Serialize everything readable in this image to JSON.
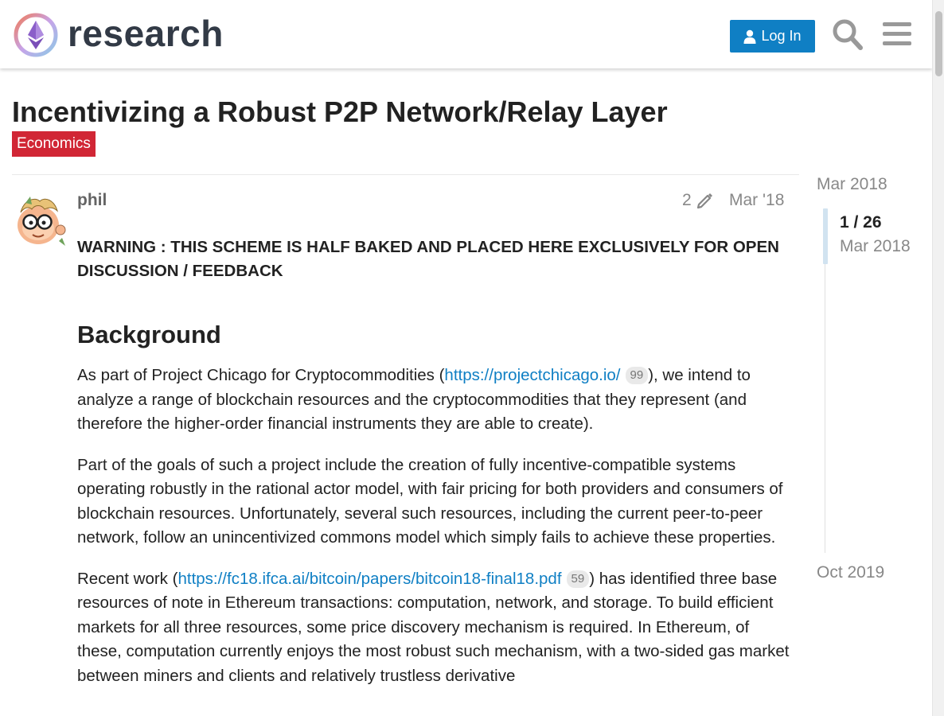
{
  "header": {
    "brand": "research",
    "login_label": "Log In",
    "icons": [
      "ethereum-logo",
      "user-icon",
      "search-icon",
      "hamburger-menu-icon"
    ]
  },
  "topic": {
    "title": "Incentivizing a Robust P2P Network/Relay Layer",
    "category": "Economics",
    "category_color": "#d12635"
  },
  "post": {
    "author": "phil",
    "edit_count": "2",
    "date": "Mar '18",
    "warning": "WARNING : THIS SCHEME IS HALF BAKED AND PLACED HERE EXCLUSIVELY FOR OPEN DISCUSSION / FEEDBACK",
    "heading": "Background",
    "p1": {
      "before": "As part of Project Chicago for Cryptocommodities (",
      "link": "https://projectchicago.io/",
      "clicks": "99",
      "after": "), we intend to analyze a range of blockchain resources and the cryptocommodities that they represent (and therefore the higher-order financial instruments they are able to create)."
    },
    "p2": "Part of the goals of such a project include the creation of fully incentive-compatible systems operating robustly in the rational actor model, with fair pricing for both providers and consumers of blockchain resources. Unfortunately, several such resources, including the current peer-to-peer network, follow an unincentivized commons model which simply fails to achieve these properties.",
    "p3": {
      "before": "Recent work (",
      "link": "https://fc18.ifca.ai/bitcoin/papers/bitcoin18-final18.pdf",
      "clicks": "59",
      "after": ") has identified three base resources of note in Ethereum transactions: computation, network, and storage. To build efficient markets for all three resources, some price discovery mechanism is required. In Ethereum, of these, computation currently enjoys the most robust such mechanism, with a two-sided gas market between miners and clients and relatively trustless derivative"
    }
  },
  "timeline": {
    "start": "Mar 2018",
    "position": "1 / 26",
    "current_date": "Mar 2018",
    "end": "Oct 2019",
    "progress_fraction": 0.04
  },
  "colors": {
    "accent": "#0f7fc4",
    "text": "#222222",
    "muted": "#888888"
  }
}
